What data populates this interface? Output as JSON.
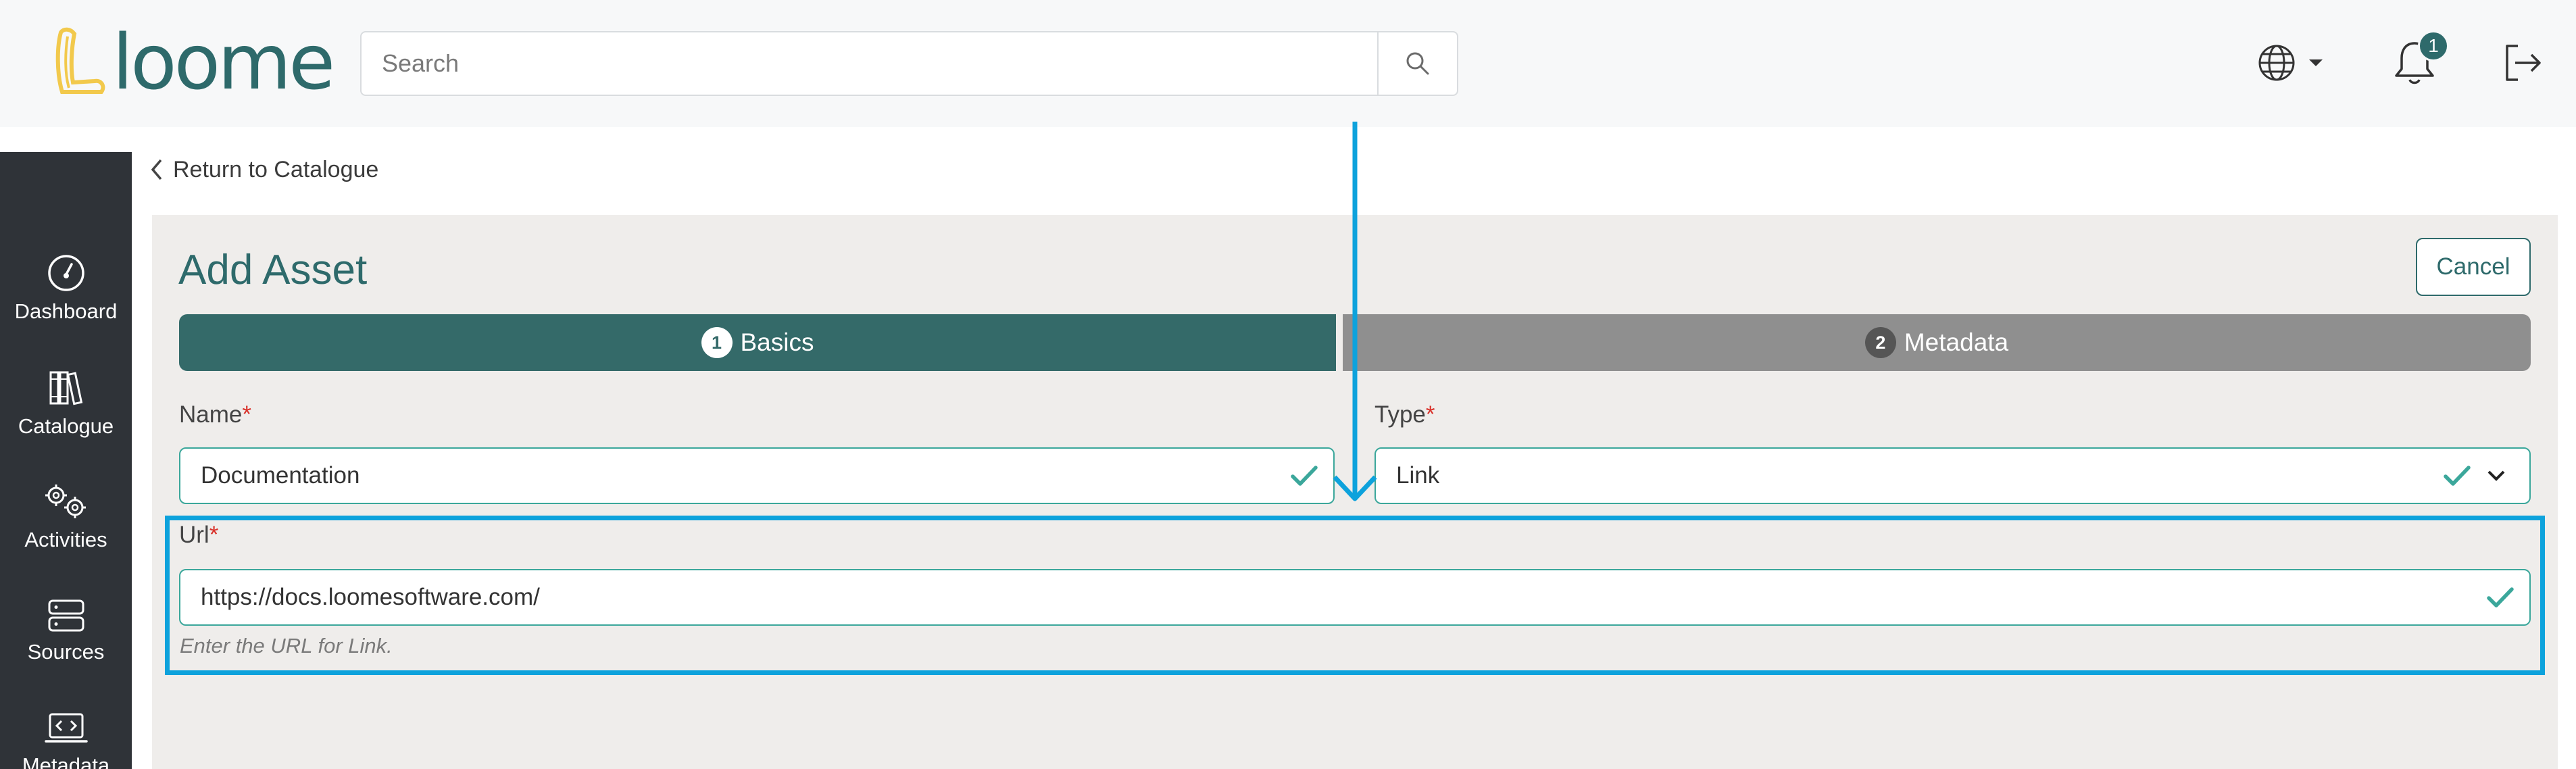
{
  "app": {
    "logo_text": "loome"
  },
  "header": {
    "search_placeholder": "Search",
    "notification_count": "1"
  },
  "sidebar": {
    "items": [
      {
        "label": "Dashboard",
        "icon": "dashboard-icon"
      },
      {
        "label": "Catalogue",
        "icon": "books-icon"
      },
      {
        "label": "Activities",
        "icon": "gears-icon"
      },
      {
        "label": "Sources",
        "icon": "server-icon"
      },
      {
        "label": "Metadata",
        "icon": "code-laptop-icon"
      }
    ]
  },
  "breadcrumb": {
    "back_label": "Return to Catalogue"
  },
  "page": {
    "title": "Add Asset",
    "cancel_label": "Cancel"
  },
  "stepper": {
    "steps": [
      {
        "number": "1",
        "label": "Basics",
        "active": true
      },
      {
        "number": "2",
        "label": "Metadata",
        "active": false
      }
    ]
  },
  "form": {
    "required_mark": "*",
    "name": {
      "label": "Name",
      "value": "Documentation"
    },
    "type": {
      "label": "Type",
      "value": "Link"
    },
    "url": {
      "label": "Url",
      "value": "https://docs.loomesoftware.com/",
      "help": "Enter the URL for Link."
    }
  },
  "colors": {
    "brand": "#2e6a6b",
    "active_step": "#346a69",
    "inactive_step": "#8f8f8f",
    "valid": "#3ba79b",
    "required": "#d9312a",
    "highlight": "#0da2dc",
    "logo_accent": "#f2c94c"
  }
}
